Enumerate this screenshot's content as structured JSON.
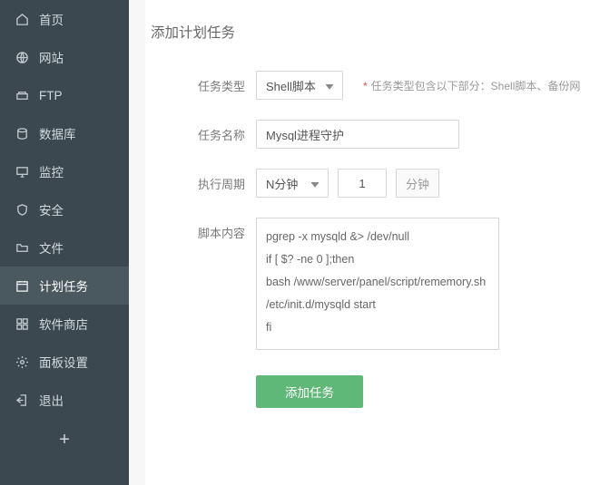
{
  "sidebar": {
    "items": [
      {
        "label": "首页",
        "icon": "home-icon"
      },
      {
        "label": "网站",
        "icon": "globe-icon"
      },
      {
        "label": "FTP",
        "icon": "ftp-icon"
      },
      {
        "label": "数据库",
        "icon": "database-icon"
      },
      {
        "label": "监控",
        "icon": "monitor-icon"
      },
      {
        "label": "安全",
        "icon": "shield-icon"
      },
      {
        "label": "文件",
        "icon": "folder-icon"
      },
      {
        "label": "计划任务",
        "icon": "calendar-icon",
        "active": true
      },
      {
        "label": "软件商店",
        "icon": "apps-icon"
      },
      {
        "label": "面板设置",
        "icon": "gear-icon"
      },
      {
        "label": "退出",
        "icon": "exit-icon"
      }
    ],
    "add_symbol": "+"
  },
  "page": {
    "title": "添加计划任务"
  },
  "form": {
    "task_type": {
      "label": "任务类型",
      "value": "Shell脚本",
      "hint_prefix": "*",
      "hint": "任务类型包含以下部分：Shell脚本、备份网"
    },
    "task_name": {
      "label": "任务名称",
      "value": "Mysql进程守护"
    },
    "cycle": {
      "label": "执行周期",
      "select_value": "N分钟",
      "number_value": "1",
      "unit": "分钟"
    },
    "script": {
      "label": "脚本内容",
      "value": "pgrep -x mysqld &> /dev/null\nif [ $? -ne 0 ];then\nbash /www/server/panel/script/rememory.sh\n/etc/init.d/mysqld start\nfi"
    },
    "submit_label": "添加任务"
  }
}
